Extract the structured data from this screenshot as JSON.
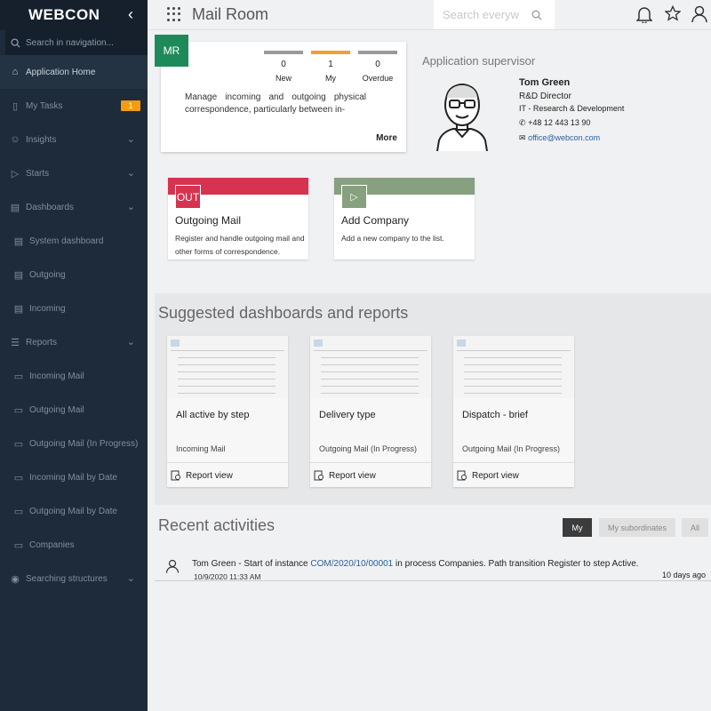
{
  "sidebar": {
    "logo": "WEBCON",
    "search_placeholder": "Search in navigation...",
    "items": [
      {
        "label": "Application Home",
        "icon": "home-icon"
      },
      {
        "label": "My Tasks",
        "icon": "bell-icon",
        "badge": "1"
      },
      {
        "label": "Insights",
        "icon": "user-search-icon"
      },
      {
        "label": "Starts",
        "icon": "play-icon"
      },
      {
        "label": "Dashboards",
        "icon": "dashboard-icon"
      },
      {
        "label": "System dashboard",
        "icon": "dashboard-icon"
      },
      {
        "label": "Outgoing",
        "icon": "dashboard-icon"
      },
      {
        "label": "Incoming",
        "icon": "dashboard-icon"
      },
      {
        "label": "Reports",
        "icon": "report-icon"
      },
      {
        "label": "Incoming Mail",
        "icon": "report-view-icon"
      },
      {
        "label": "Outgoing Mail",
        "icon": "report-view-icon"
      },
      {
        "label": "Outgoing Mail (In Progress)",
        "icon": "report-view-icon"
      },
      {
        "label": "Incoming Mail by Date",
        "icon": "report-view-icon"
      },
      {
        "label": "Outgoing Mail by Date",
        "icon": "report-view-icon"
      },
      {
        "label": "Companies",
        "icon": "report-view-icon"
      },
      {
        "label": "Searching structures",
        "icon": "structure-icon"
      }
    ]
  },
  "topbar": {
    "title": "Mail Room",
    "search_placeholder": "Search everyw"
  },
  "app_card": {
    "initials": "MR",
    "stats": [
      {
        "count": "0",
        "label": "New",
        "color": "#9a9a9a"
      },
      {
        "count": "1",
        "label": "My",
        "color": "#f0a030"
      },
      {
        "count": "0",
        "label": "Overdue",
        "color": "#9a9a9a"
      }
    ],
    "description": "Manage incoming and outgoing physical correspondence, particularly between in-",
    "more_label": "More"
  },
  "supervisor": {
    "title": "Application supervisor",
    "name": "Tom Green",
    "role": "R&D Director",
    "department": "IT - Research & Development",
    "phone": "+48 12 443 13 90",
    "email": "office@webcon.com"
  },
  "start_tiles": [
    {
      "icon_text": "OUT",
      "title": "Outgoing Mail",
      "description": "Register and handle outgoing mail and other forms of correspondence.",
      "color": "#d63350"
    },
    {
      "icon_text": "▷",
      "title": "Add Company",
      "description": "Add a new company to the list.",
      "color": "#87a07f"
    }
  ],
  "dashboards": {
    "title": "Suggested dashboards and reports",
    "cards": [
      {
        "name": "All active by step",
        "source": "Incoming Mail",
        "view_label": "Report view"
      },
      {
        "name": "Delivery type",
        "source": "Outgoing Mail (In Progress)",
        "view_label": "Report view"
      },
      {
        "name": "Dispatch - brief",
        "source": "Outgoing Mail (In Progress)",
        "view_label": "Report view"
      }
    ]
  },
  "recent": {
    "title": "Recent activities",
    "filters": [
      "My",
      "My subordinates",
      "All"
    ],
    "activity": {
      "user": "Tom Green",
      "t1": " - Start of instance ",
      "instance": "COM/2020/10/00001",
      "t2": " in process ",
      "process": "Companies",
      "t3": ". Path transition ",
      "path": "Register",
      "t4": " to step ",
      "step": "Active.",
      "date": "10/9/2020 11:33 AM",
      "ago": "10 days ago"
    }
  }
}
